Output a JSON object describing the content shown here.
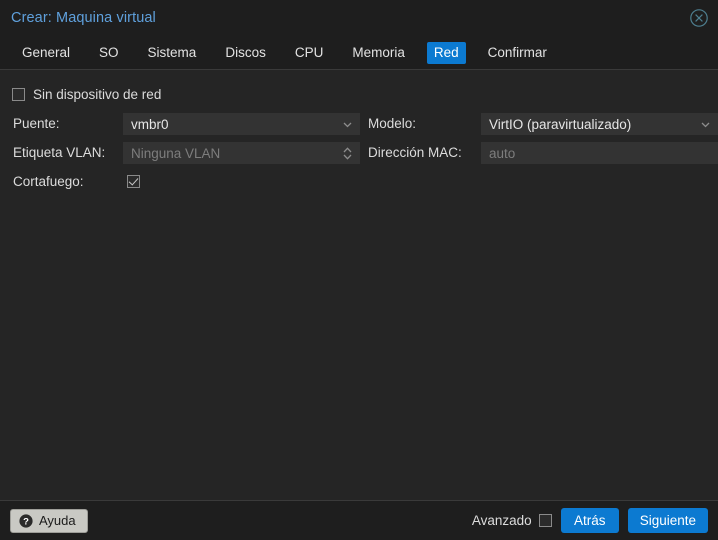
{
  "window": {
    "title": "Crear: Maquina virtual",
    "close_icon": "close-circle-icon"
  },
  "tabs": [
    {
      "label": "General",
      "active": false
    },
    {
      "label": "SO",
      "active": false
    },
    {
      "label": "Sistema",
      "active": false
    },
    {
      "label": "Discos",
      "active": false
    },
    {
      "label": "CPU",
      "active": false
    },
    {
      "label": "Memoria",
      "active": false
    },
    {
      "label": "Red",
      "active": true
    },
    {
      "label": "Confirmar",
      "active": false
    }
  ],
  "form": {
    "no_network_device": {
      "label": "Sin dispositivo de red",
      "checked": false
    },
    "bridge": {
      "label": "Puente:",
      "value": "vmbr0",
      "icon": "chevron-down-icon"
    },
    "vlan_tag": {
      "label": "Etiqueta VLAN:",
      "placeholder": "Ninguna VLAN",
      "value": "",
      "icon": "spinner-updown-icon"
    },
    "firewall": {
      "label": "Cortafuego:",
      "checked": true
    },
    "model": {
      "label": "Modelo:",
      "value": "VirtIO (paravirtualizado)",
      "icon": "chevron-down-icon"
    },
    "mac_address": {
      "label": "Dirección MAC:",
      "placeholder": "auto",
      "value": ""
    }
  },
  "footer": {
    "help_label": "Ayuda",
    "help_icon": "question-mark-icon",
    "advanced_label": "Avanzado",
    "advanced_checked": false,
    "back_label": "Atrás",
    "next_label": "Siguiente"
  },
  "colors": {
    "accent": "#0c7ad1",
    "title": "#5fa0dc",
    "window_bg": "#222222",
    "content_bg": "#252525",
    "field_bg": "#333333"
  }
}
